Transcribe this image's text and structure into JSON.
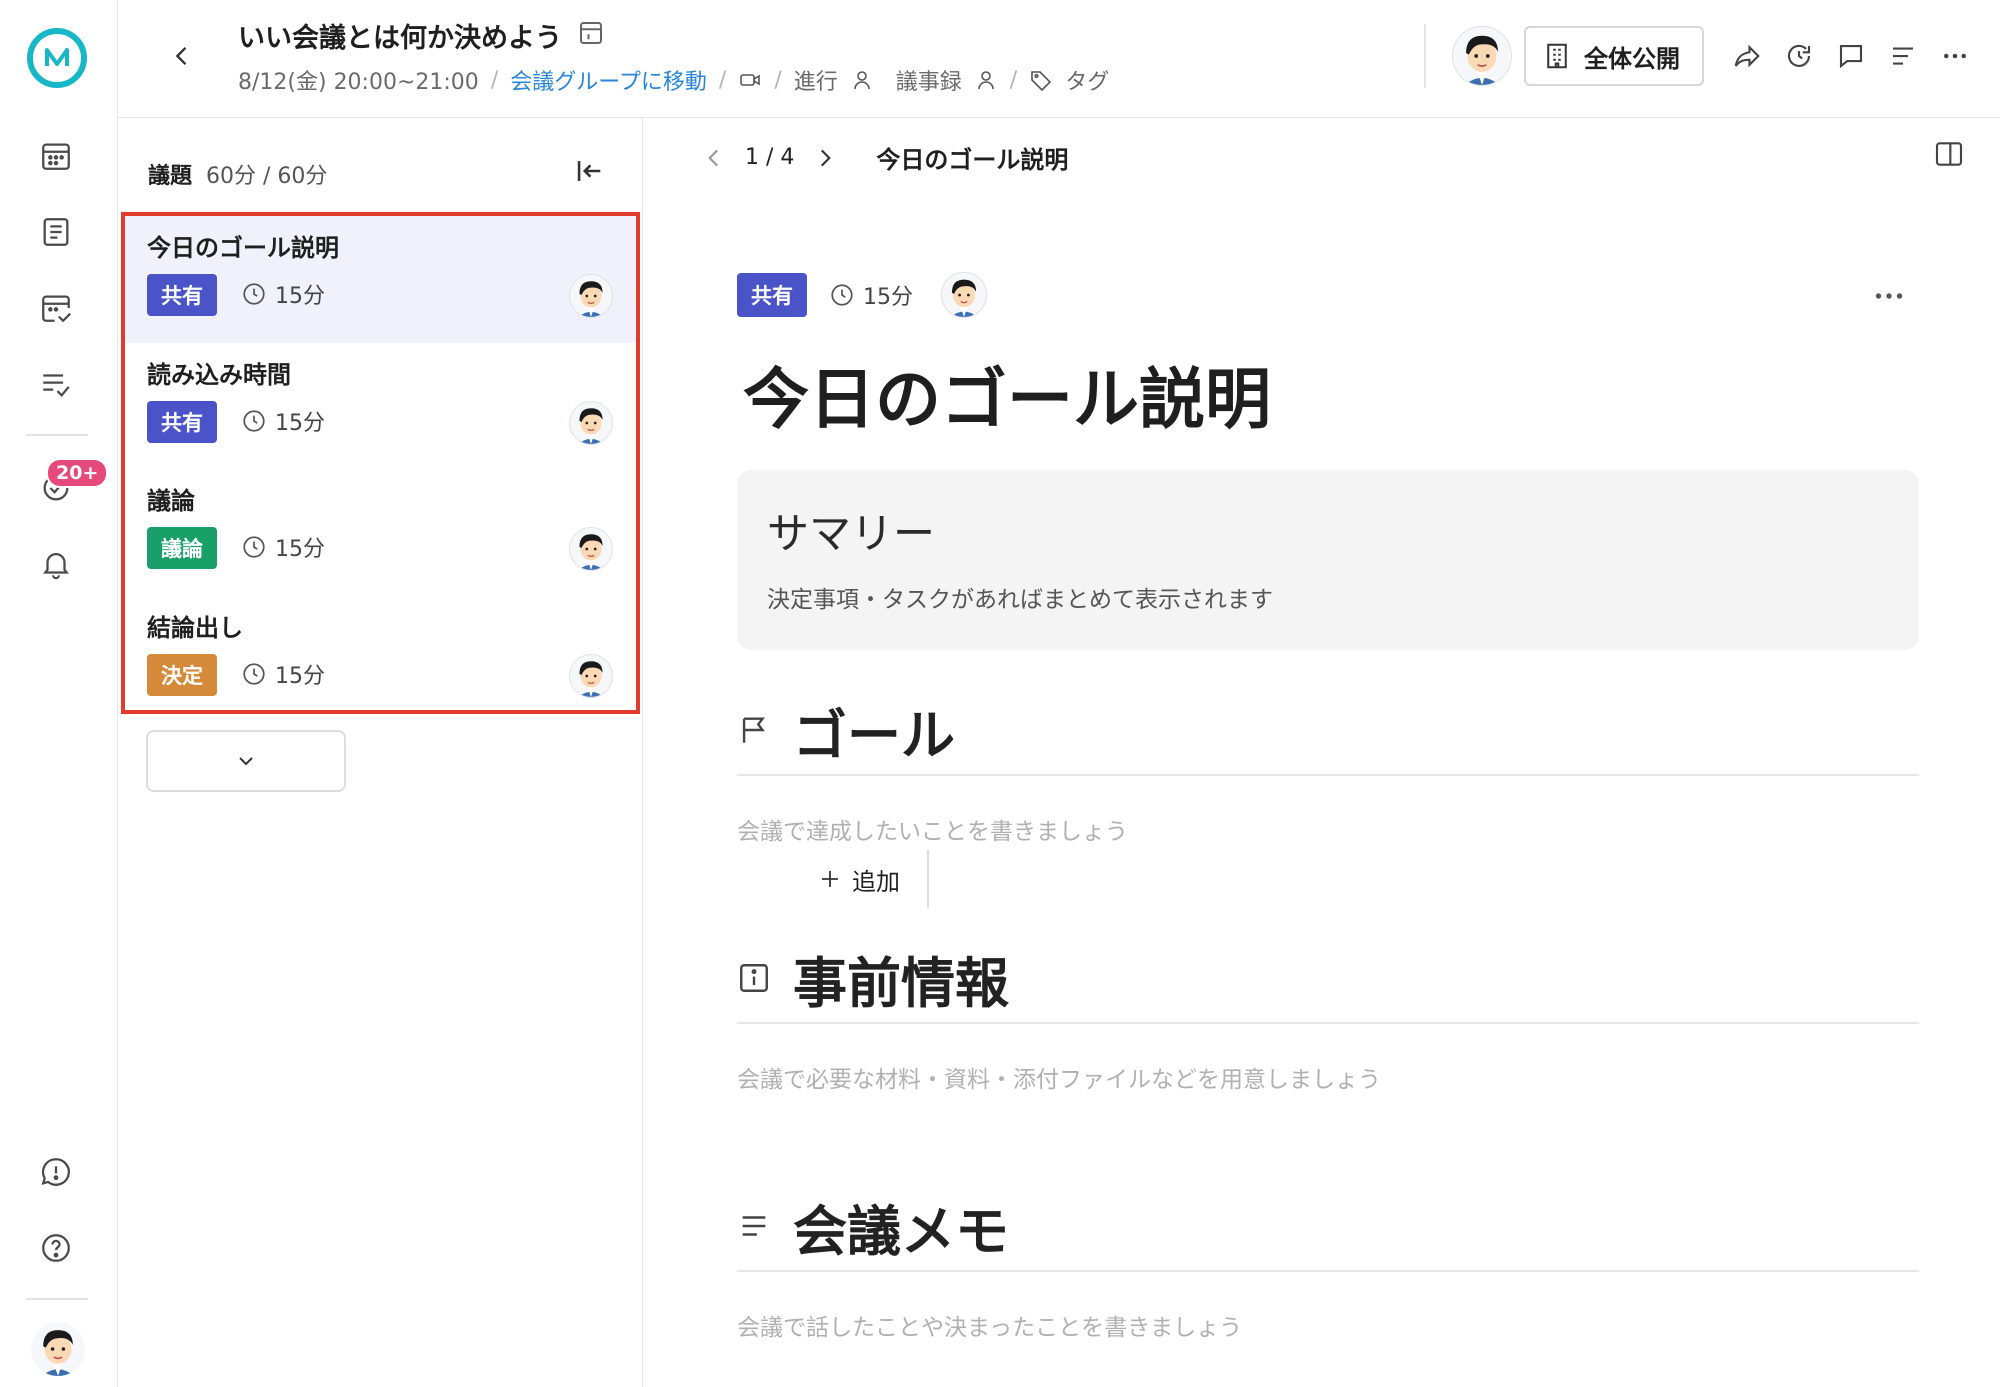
{
  "rail": {
    "badge": "20+",
    "icons": [
      "logo-icon",
      "calendar-icon",
      "document-icon",
      "task-calendar-icon",
      "checklist-icon",
      "activity-icon",
      "bell-icon",
      "feedback-icon",
      "help-icon"
    ]
  },
  "header": {
    "title": "いい会議とは何か決めよう",
    "datetime": "8/12(金) 20:00~21:00",
    "group_link": "会議グループに移動",
    "facilitator": "進行",
    "minutes": "議事録",
    "tag": "タグ",
    "publish_label": "全体公開"
  },
  "agenda": {
    "label": "議題",
    "time_summary": "60分 / 60分",
    "items": [
      {
        "title": "今日のゴール説明",
        "tag": "共有",
        "tag_color": "#4a54c8",
        "duration": "15分"
      },
      {
        "title": "読み込み時間",
        "tag": "共有",
        "tag_color": "#4a54c8",
        "duration": "15分"
      },
      {
        "title": "議論",
        "tag": "議論",
        "tag_color": "#19a068",
        "duration": "15分"
      },
      {
        "title": "結論出し",
        "tag": "決定",
        "tag_color": "#d58a3a",
        "duration": "15分"
      }
    ],
    "add_label": "追加"
  },
  "main": {
    "pager_current": "1",
    "pager_total": "4",
    "pager_title": "今日のゴール説明",
    "tag": "共有",
    "duration": "15分",
    "title": "今日のゴール説明",
    "summary_title": "サマリー",
    "summary_text": "決定事項・タスクがあればまとめて表示されます",
    "sections": [
      {
        "title": "ゴール",
        "placeholder": "会議で達成したいことを書きましょう"
      },
      {
        "title": "事前情報",
        "placeholder": "会議で必要な材料・資料・添付ファイルなどを用意しましょう"
      },
      {
        "title": "会議メモ",
        "placeholder": "会議で話したことや決まったことを書きましょう"
      }
    ]
  },
  "colors": {
    "accent": "#17b7c7",
    "link": "#2a86d6",
    "highlight_border": "#e23b2e",
    "badge": "#e64a7b"
  }
}
